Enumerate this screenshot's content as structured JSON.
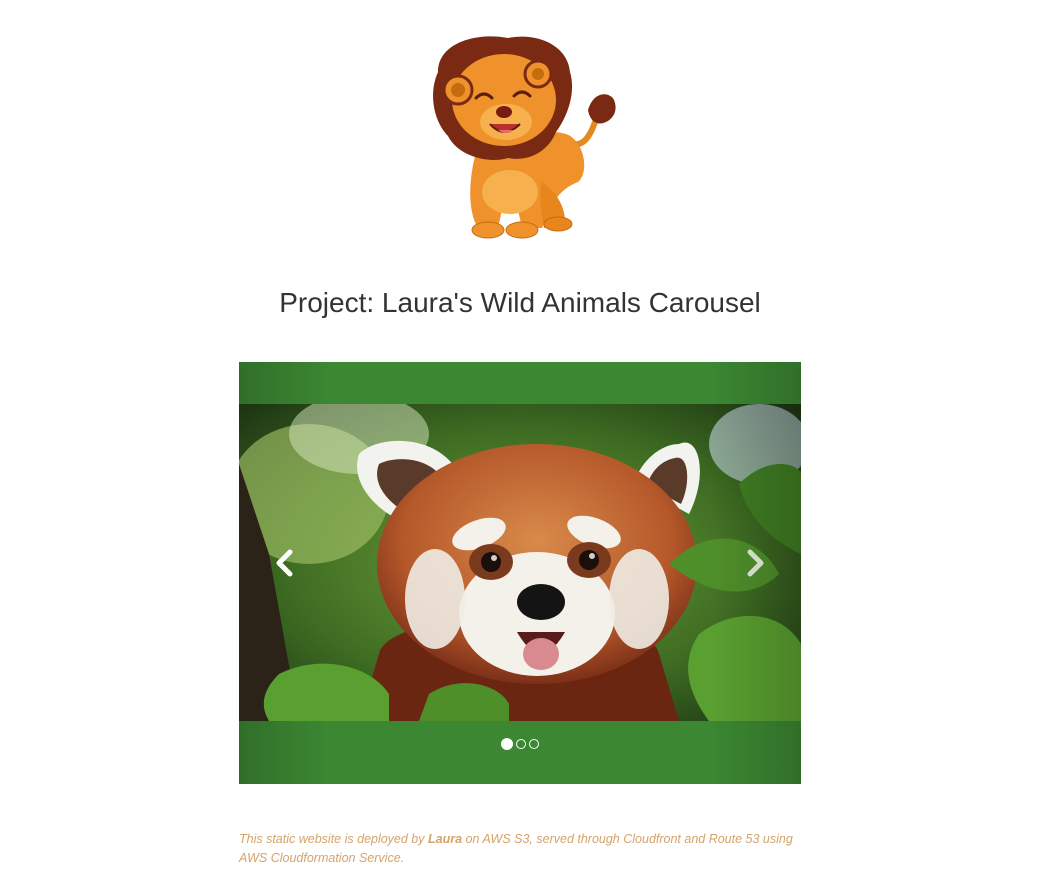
{
  "page": {
    "title": "Project: Laura's Wild Animals Carousel"
  },
  "logo": {
    "icon": "cartoon-lion-icon"
  },
  "carousel": {
    "background_color": "#3b8732",
    "active_index": 0,
    "slides": [
      {
        "subject": "red-panda"
      },
      {
        "subject": ""
      },
      {
        "subject": ""
      }
    ],
    "prev_icon": "chevron-left-icon",
    "next_icon": "chevron-right-icon"
  },
  "footer": {
    "part1": "This static website is deployed by ",
    "author": "Laura",
    "part2": " on AWS S3, served through Cloudfront and Route 53 using AWS Cloudformation Service.",
    "color": "#d4a36a"
  }
}
